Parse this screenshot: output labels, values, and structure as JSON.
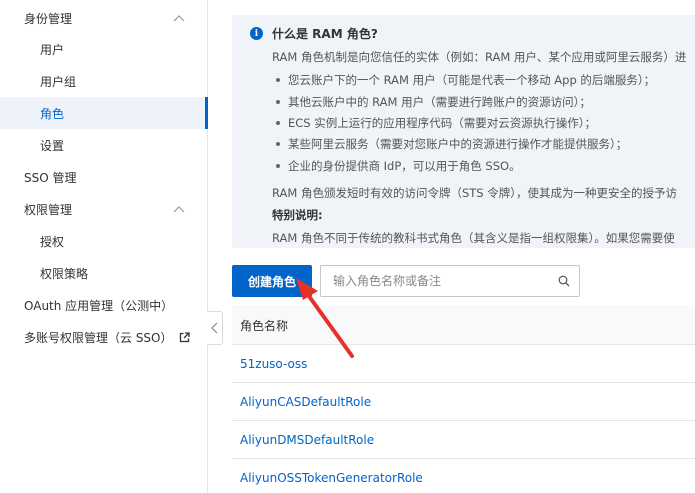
{
  "sidebar": {
    "items": [
      {
        "label": "身份管理",
        "kind": "group",
        "expanded": true
      },
      {
        "label": "用户",
        "kind": "sub"
      },
      {
        "label": "用户组",
        "kind": "sub"
      },
      {
        "label": "角色",
        "kind": "sub",
        "active": true
      },
      {
        "label": "设置",
        "kind": "sub"
      },
      {
        "label": "SSO 管理",
        "kind": "group"
      },
      {
        "label": "权限管理",
        "kind": "group",
        "expanded": true
      },
      {
        "label": "授权",
        "kind": "sub"
      },
      {
        "label": "权限策略",
        "kind": "sub"
      },
      {
        "label": "OAuth 应用管理（公测中）",
        "kind": "group"
      },
      {
        "label": "多账号权限管理（云 SSO）",
        "kind": "group",
        "external": true
      }
    ]
  },
  "info": {
    "icon": "info-icon",
    "title": "什么是 RAM 角色?",
    "intro": "RAM 角色机制是向您信任的实体（例如：RAM 用户、某个应用或阿里云服务）进",
    "bullets": [
      "您云账户下的一个 RAM 用户（可能是代表一个移动 App 的后端服务）；",
      "其他云账户中的 RAM 用户（需要进行跨账户的资源访问）；",
      "ECS 实例上运行的应用程序代码（需要对云资源执行操作）；",
      "某些阿里云服务（需要对您账户中的资源进行操作才能提供服务）；",
      "企业的身份提供商 IdP，可以用于角色 SSO。"
    ],
    "sts_line": "RAM 角色颁发短时有效的访问令牌（STS 令牌），使其成为一种更安全的授予访",
    "special_title": "特别说明:",
    "special_text": "RAM 角色不同于传统的教科书式角色（其含义是指一组权限集）。如果您需要使"
  },
  "toolbar": {
    "create_label": "创建角色",
    "search_placeholder": "输入角色名称或备注",
    "search_value": ""
  },
  "table": {
    "column_header": "角色名称",
    "rows": [
      "51zuso-oss",
      "AliyunCASDefaultRole",
      "AliyunDMSDefaultRole",
      "AliyunOSSTokenGeneratorRole"
    ]
  },
  "colors": {
    "accent": "#0064c8",
    "annotation": "#e8302a",
    "info_bg": "#f0f3f7"
  }
}
